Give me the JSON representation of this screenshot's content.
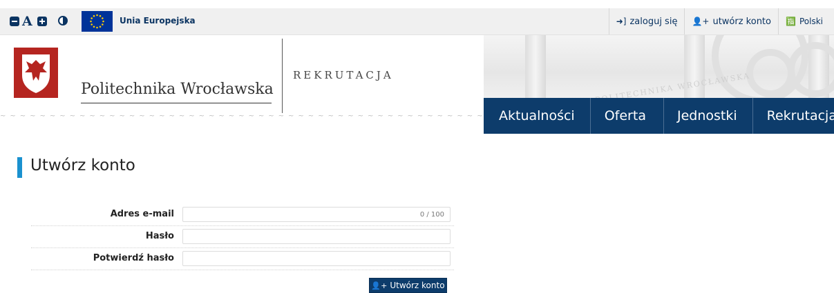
{
  "accessibility": {
    "font_smaller_icon": "minus-square-icon",
    "font_label": "A",
    "font_larger_icon": "plus-square-icon",
    "contrast_icon": "contrast-icon"
  },
  "eu": {
    "label": "Unia Europejska",
    "flag_icon": "eu-flag-icon"
  },
  "topbar": {
    "login_label": "zaloguj się",
    "login_icon": "sign-in-icon",
    "register_label": "utwórz konto",
    "register_icon": "user-plus-icon",
    "language_label": "Polski",
    "language_icon": "language-icon"
  },
  "header": {
    "university_name": "Politechnika Wrocławska",
    "section_title": "REKRUTACJA"
  },
  "nav": {
    "items": [
      {
        "label": "Aktualności"
      },
      {
        "label": "Oferta"
      },
      {
        "label": "Jednostki"
      },
      {
        "label": "Rekrutacja"
      }
    ]
  },
  "page": {
    "title": "Utwórz konto"
  },
  "form": {
    "email_label": "Adres e-mail",
    "email_value": "",
    "email_counter": "0 / 100",
    "password_label": "Hasło",
    "password_value": "",
    "confirm_label": "Potwierdź hasło",
    "confirm_value": "",
    "submit_label": "Utwórz konto"
  },
  "colors": {
    "navy": "#0d3c6b",
    "accent_blue": "#1a91cf",
    "logo_red": "#b52520",
    "eu_blue": "#003399"
  }
}
